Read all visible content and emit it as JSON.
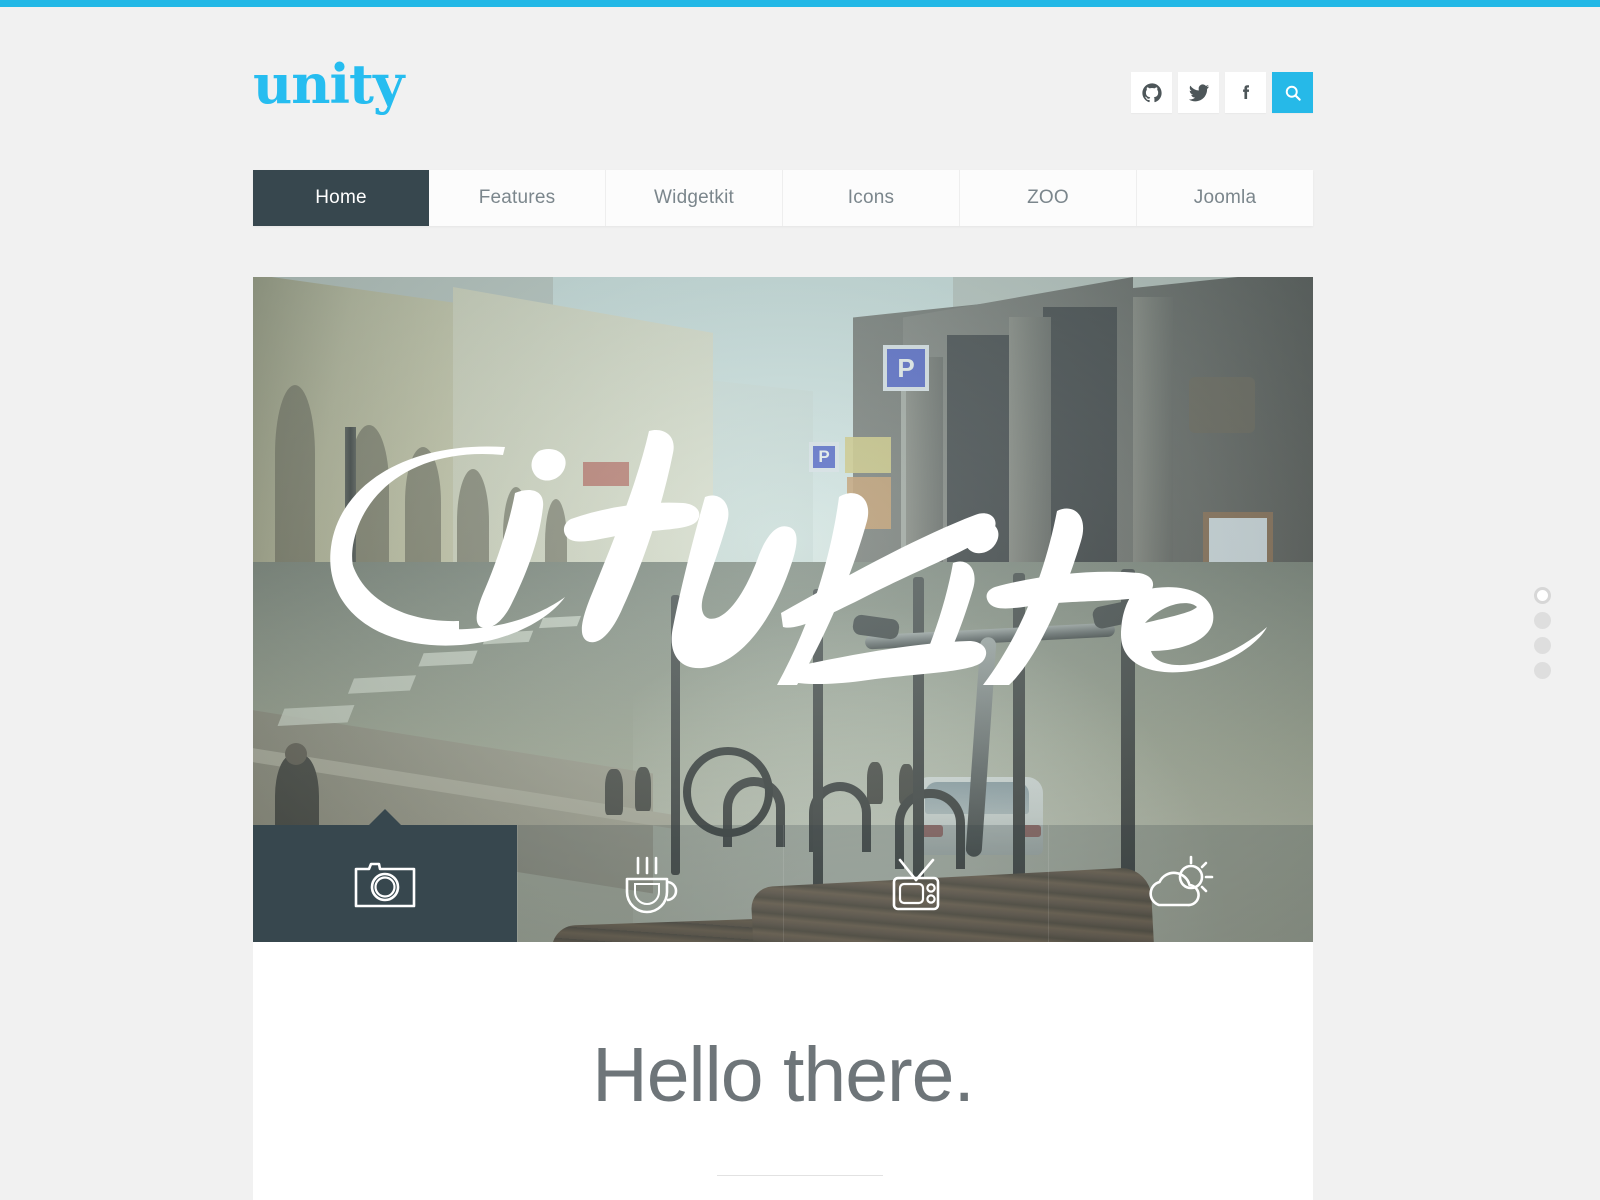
{
  "theme": {
    "accent": "#22b8e6",
    "dark": "#37474e",
    "page_bg": "#f1f1f1",
    "nav_text": "#7b868c",
    "heading_text": "#6e7579"
  },
  "header": {
    "logo_text": "unity",
    "social": [
      {
        "name": "github",
        "label": "GitHub"
      },
      {
        "name": "twitter",
        "label": "Twitter"
      },
      {
        "name": "facebook",
        "label": "Facebook"
      }
    ],
    "search": {
      "label": "Search",
      "icon": "search-icon"
    }
  },
  "nav": {
    "items": [
      {
        "label": "Home",
        "active": true
      },
      {
        "label": "Features",
        "active": false
      },
      {
        "label": "Widgetkit",
        "active": false
      },
      {
        "label": "Icons",
        "active": false
      },
      {
        "label": "ZOO",
        "active": false
      },
      {
        "label": "Joomla",
        "active": false
      }
    ]
  },
  "hero": {
    "overlay_script_text": "CityLife",
    "image_alt": "City street with parked bicycles and wet asphalt road",
    "tabs": [
      {
        "icon": "camera-icon",
        "label": "Photo",
        "active": true
      },
      {
        "icon": "coffee-icon",
        "label": "Coffee",
        "active": false
      },
      {
        "icon": "tv-icon",
        "label": "TV",
        "active": false
      },
      {
        "icon": "weather-icon",
        "label": "Weather",
        "active": false
      }
    ]
  },
  "slider": {
    "dots": [
      {
        "index": 1,
        "active": true
      },
      {
        "index": 2,
        "active": false
      },
      {
        "index": 3,
        "active": false
      },
      {
        "index": 4,
        "active": false
      }
    ]
  },
  "content": {
    "heading": "Hello there."
  }
}
